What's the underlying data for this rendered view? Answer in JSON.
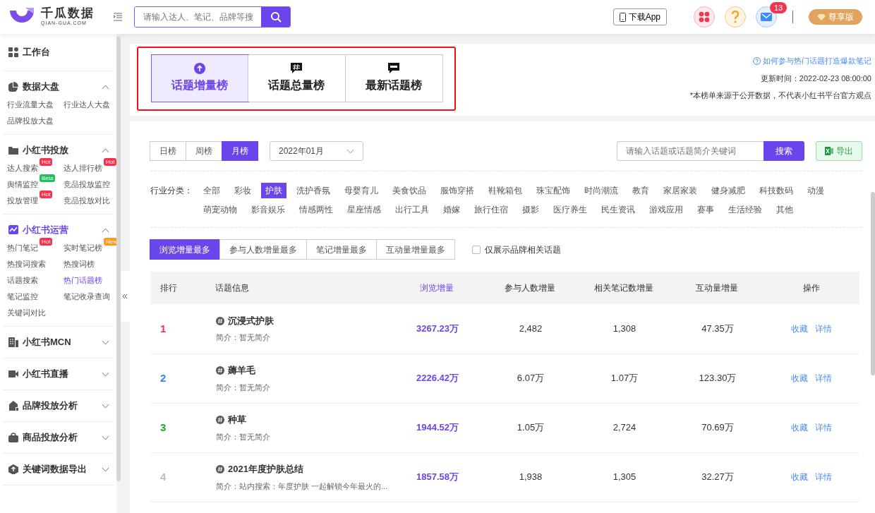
{
  "header": {
    "logo_title": "千瓜数据",
    "logo_subtitle": "QIAN-GUA.COM",
    "search_placeholder": "请输入达人、笔记、品牌等搜",
    "download_app": "下载App",
    "message_count": "13",
    "vip": "尊享版"
  },
  "sidebar": {
    "sections": [
      {
        "label": "工作台",
        "active": false
      },
      {
        "label": "数据大盘",
        "active": false,
        "expanded": true,
        "items": [
          {
            "label": "行业流量大盘",
            "selected": false
          },
          {
            "label": "行业达人大盘",
            "selected": false
          },
          {
            "label": "品牌投放大盘",
            "selected": false
          }
        ]
      },
      {
        "label": "小红书投放",
        "active": false,
        "expanded": true,
        "items": [
          {
            "label": "达人搜索",
            "selected": false,
            "badge": "Hot",
            "color": "#f5334f"
          },
          {
            "label": "达人排行榜",
            "selected": false,
            "badge": "Hot",
            "color": "#f5334f"
          },
          {
            "label": "舆情监控",
            "selected": false,
            "badge": "Beta",
            "color": "#1fc15c"
          },
          {
            "label": "竞品投放监控",
            "selected": false
          },
          {
            "label": "投放管理",
            "selected": false,
            "badge": "Hot",
            "color": "#f5334f"
          },
          {
            "label": "竞品投放对比",
            "selected": false
          }
        ]
      },
      {
        "label": "小红书运营",
        "active": true,
        "expanded": true,
        "items": [
          {
            "label": "热门笔记",
            "selected": false,
            "badge": "Hot",
            "color": "#f5334f"
          },
          {
            "label": "实时笔记榜",
            "selected": false,
            "badge": "New",
            "color": "#ff9a1f"
          },
          {
            "label": "热搜词搜索",
            "selected": false
          },
          {
            "label": "热搜词榜",
            "selected": false
          },
          {
            "label": "话题搜索",
            "selected": false
          },
          {
            "label": "热门话题榜",
            "selected": true
          },
          {
            "label": "笔记监控",
            "selected": false
          },
          {
            "label": "笔记收录查询",
            "selected": false
          },
          {
            "label": "关键词对比",
            "selected": false
          }
        ]
      },
      {
        "label": "小红书MCN",
        "active": false,
        "expanded": false
      },
      {
        "label": "小红书直播",
        "active": false,
        "expanded": false
      },
      {
        "label": "品牌投放分析",
        "active": false,
        "expanded": false
      },
      {
        "label": "商品投放分析",
        "active": false,
        "expanded": false
      },
      {
        "label": "关键词数据导出",
        "active": false,
        "expanded": false
      }
    ]
  },
  "board_tabs": [
    {
      "label": "话题增量榜",
      "selected": true
    },
    {
      "label": "话题总量榜",
      "selected": false
    },
    {
      "label": "最新话题榜",
      "selected": false
    }
  ],
  "help_link": "如何参与热门话题打造爆款笔记",
  "update_time": "更新时间：2022-02-23 08:00:00",
  "disclaimer": "*本榜单来源于公开数据，不代表小红书平台官方观点",
  "period_tabs": [
    {
      "label": "日榜",
      "selected": false
    },
    {
      "label": "周榜",
      "selected": false
    },
    {
      "label": "月榜",
      "selected": true
    }
  ],
  "month_select": "2022年01月",
  "topic_search": {
    "placeholder": "请输入话题或话题简介关键词",
    "button": "搜索"
  },
  "export_button": "导出",
  "industry_label": "行业分类：",
  "industries": [
    {
      "label": "全部",
      "selected": false
    },
    {
      "label": "彩妆",
      "selected": false
    },
    {
      "label": "护肤",
      "selected": true
    },
    {
      "label": "洗护香氛",
      "selected": false
    },
    {
      "label": "母婴育儿",
      "selected": false
    },
    {
      "label": "美食饮品",
      "selected": false
    },
    {
      "label": "服饰穿搭",
      "selected": false
    },
    {
      "label": "鞋靴箱包",
      "selected": false
    },
    {
      "label": "珠宝配饰",
      "selected": false
    },
    {
      "label": "时尚潮流",
      "selected": false
    },
    {
      "label": "教育",
      "selected": false
    },
    {
      "label": "家居家装",
      "selected": false
    },
    {
      "label": "健身减肥",
      "selected": false
    },
    {
      "label": "科技数码",
      "selected": false
    },
    {
      "label": "动漫",
      "selected": false
    },
    {
      "label": "萌宠动物",
      "selected": false
    },
    {
      "label": "影音娱乐",
      "selected": false
    },
    {
      "label": "情感两性",
      "selected": false
    },
    {
      "label": "星座情感",
      "selected": false
    },
    {
      "label": "出行工具",
      "selected": false
    },
    {
      "label": "婚嫁",
      "selected": false
    },
    {
      "label": "旅行住宿",
      "selected": false
    },
    {
      "label": "摄影",
      "selected": false
    },
    {
      "label": "医疗养生",
      "selected": false
    },
    {
      "label": "民生资讯",
      "selected": false
    },
    {
      "label": "游戏应用",
      "selected": false
    },
    {
      "label": "赛事",
      "selected": false
    },
    {
      "label": "生活经验",
      "selected": false
    },
    {
      "label": "其他",
      "selected": false
    }
  ],
  "sort_tabs": [
    {
      "label": "浏览增量最多",
      "selected": true
    },
    {
      "label": "参与人数增量最多",
      "selected": false
    },
    {
      "label": "笔记增量最多",
      "selected": false
    },
    {
      "label": "互动量增量最多",
      "selected": false
    }
  ],
  "brand_only": {
    "label": "仅展示品牌相关话题",
    "checked": false
  },
  "table": {
    "columns": [
      {
        "label": "排行",
        "selected": false
      },
      {
        "label": "话题信息",
        "selected": false
      },
      {
        "label": "浏览增量",
        "selected": true
      },
      {
        "label": "参与人数增量",
        "selected": false
      },
      {
        "label": "相关笔记数增量",
        "selected": false
      },
      {
        "label": "互动量增量",
        "selected": false
      },
      {
        "label": "操作",
        "selected": false
      }
    ],
    "rows": [
      {
        "rank": "1",
        "color": "#f5334f",
        "title": "沉浸式护肤",
        "intro": "简介：暂无简介",
        "views": "3267.23万",
        "participants": "2,482",
        "notes": "1,308",
        "interactions": "47.35万",
        "actions": [
          "收藏",
          "详情"
        ]
      },
      {
        "rank": "2",
        "color": "#3d7ef5",
        "title": "薅羊毛",
        "intro": "简介：暂无简介",
        "views": "2226.42万",
        "participants": "6.07万",
        "notes": "1.07万",
        "interactions": "123.30万",
        "actions": [
          "收藏",
          "详情"
        ]
      },
      {
        "rank": "3",
        "color": "#1aaa2e",
        "title": "种草",
        "intro": "简介：暂无简介",
        "views": "1944.52万",
        "participants": "1.05万",
        "notes": "2,724",
        "interactions": "70.69万",
        "actions": [
          "收藏",
          "详情"
        ]
      },
      {
        "rank": "4",
        "color": "#bbbbbb",
        "title": "2021年度护肤总结",
        "intro": "简介：站内搜索：年度护肤 一起解锁今年最火的...",
        "views": "1857.58万",
        "participants": "1,938",
        "notes": "1,305",
        "interactions": "32.27万",
        "actions": [
          "收藏",
          "详情"
        ]
      }
    ]
  }
}
